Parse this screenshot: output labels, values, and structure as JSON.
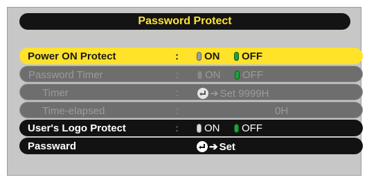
{
  "title": "Password Protect",
  "rows": {
    "power_on": {
      "label": "Power ON Protect",
      "colon": ":",
      "on": "ON",
      "off": "OFF"
    },
    "password_timer": {
      "label": "Password Timer",
      "colon": ":",
      "on": "ON",
      "off": "OFF"
    },
    "timer": {
      "label": "Timer",
      "colon": ":",
      "action": "Set 9999H"
    },
    "time_elapsed": {
      "label": "Time-elapsed",
      "colon": ":",
      "value": "0H"
    },
    "logo_protect": {
      "label": "User's Logo Protect",
      "colon": ":",
      "on": "ON",
      "off": "OFF"
    },
    "password": {
      "label": "Passward",
      "action": "Set"
    }
  },
  "icons": {
    "indicator_off": "gray-pill-icon",
    "indicator_on": "green-pill-icon",
    "enter": "enter-key-icon",
    "arrow": "right-arrow-icon"
  },
  "colors": {
    "highlight": "#ffe22a",
    "title_text": "#ffe23c",
    "selected_indicator": "#1ea23a"
  }
}
